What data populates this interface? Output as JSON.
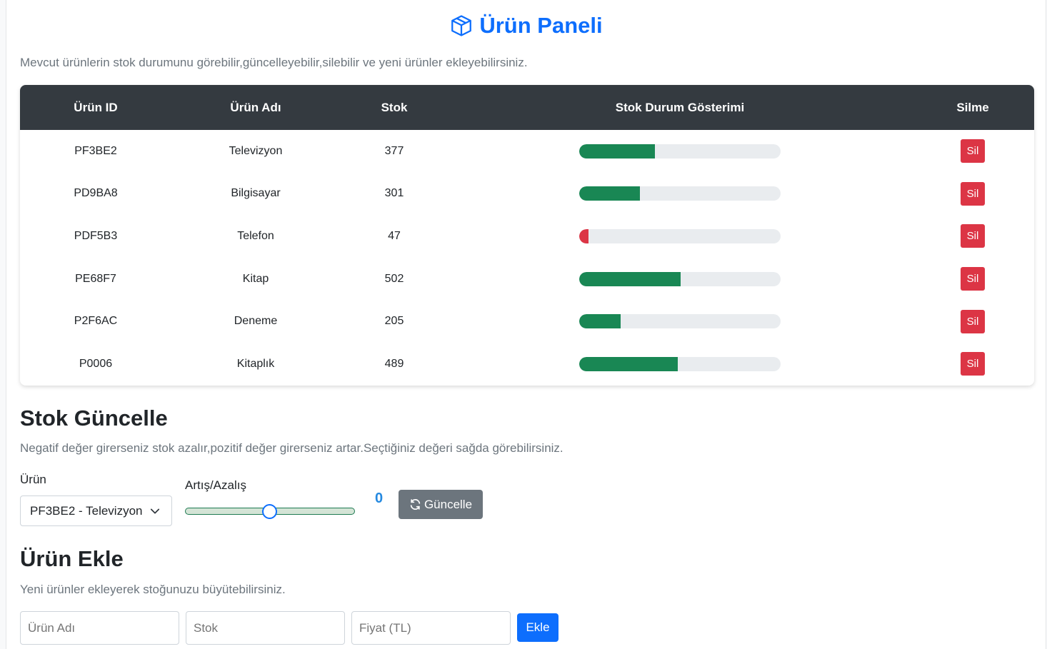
{
  "header": {
    "title": "Ürün Paneli",
    "subtitle": "Mevcut ürünlerin stok durumunu görebilir,güncelleyebilir,silebilir ve yeni ürünler ekleyebilirsiniz.",
    "title_icon": "box-icon"
  },
  "table": {
    "columns": [
      "Ürün ID",
      "Ürün Adı",
      "Stok",
      "Stok Durum Gösterimi",
      "Silme"
    ],
    "delete_label": "Sil",
    "rows": [
      {
        "id": "PF3BE2",
        "name": "Televizyon",
        "stock": "377",
        "level": 0.377,
        "color": "#198754"
      },
      {
        "id": "PD9BA8",
        "name": "Bilgisayar",
        "stock": "301",
        "level": 0.301,
        "color": "#198754"
      },
      {
        "id": "PDF5B3",
        "name": "Telefon",
        "stock": "47",
        "level": 0.047,
        "color": "#dc3545"
      },
      {
        "id": "PE68F7",
        "name": "Kitap",
        "stock": "502",
        "level": 0.502,
        "color": "#198754"
      },
      {
        "id": "P2F6AC",
        "name": "Deneme",
        "stock": "205",
        "level": 0.205,
        "color": "#198754"
      },
      {
        "id": "P0006",
        "name": "Kitaplık",
        "stock": "489",
        "level": 0.489,
        "color": "#198754"
      }
    ]
  },
  "update": {
    "heading": "Stok Güncelle",
    "help": "Negatif değer girerseniz stok azalır,pozitif değer girerseniz artar.Seçtiğiniz değeri sağda görebilirsiniz.",
    "product_label": "Ürün",
    "product_value": "PF3BE2 - Televizyon",
    "slider_label": "Artış/Azalış",
    "slider_value": "0",
    "button_label": "Güncelle"
  },
  "add": {
    "heading": "Ürün Ekle",
    "help": "Yeni ürünler ekleyerek stoğunuzu büyütebilirsiniz.",
    "name_placeholder": "Ürün Adı",
    "stock_placeholder": "Stok",
    "price_placeholder": "Fiyat (TL)",
    "button_label": "Ekle"
  },
  "colors": {
    "primary": "#0d6efd",
    "success": "#198754",
    "danger": "#dc3545",
    "secondary": "#6c757d",
    "table_header": "#343a40"
  }
}
